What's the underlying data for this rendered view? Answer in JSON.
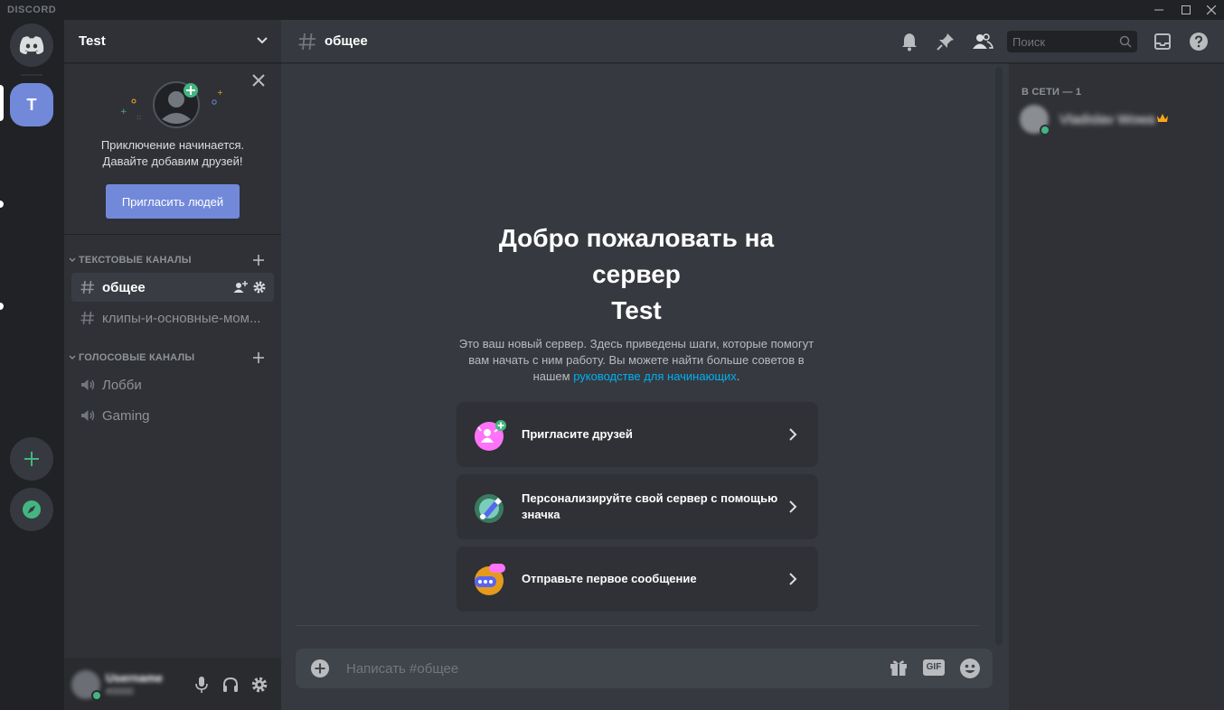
{
  "titlebar": {
    "brand": "DISCORD"
  },
  "rail": {
    "active_server_initial": "T",
    "colors": {
      "active": "#7289da",
      "add": "#43b581",
      "explore": "#43b581"
    }
  },
  "sidebar": {
    "server_name": "Test",
    "invite_card": {
      "text_line1": "Приключение начинается.",
      "text_line2": "Давайте добавим друзей!",
      "button_label": "Пригласить людей"
    },
    "text_category": "ТЕКСТОВЫЕ КАНАЛЫ",
    "text_channels": [
      {
        "name": "общее"
      },
      {
        "name": "клипы-и-основные-мом..."
      }
    ],
    "voice_category": "ГОЛОСОВЫЕ КАНАЛЫ",
    "voice_channels": [
      {
        "name": "Лобби"
      },
      {
        "name": "Gaming"
      }
    ],
    "user": {
      "name": "Username",
      "tag": "#0000"
    }
  },
  "main": {
    "channel_title": "общее",
    "search_placeholder": "Поиск",
    "welcome": {
      "title_line1": "Добро пожаловать на",
      "title_line2": "сервер",
      "title_line3": "Test",
      "desc_part1": "Это ваш новый сервер. Здесь приведены шаги, которые помогут вам начать с ним работу. Вы можете найти больше советов в нашем ",
      "desc_link": "руководстве для начинающих",
      "desc_end": "."
    },
    "cards": [
      {
        "label": "Пригласите друзей"
      },
      {
        "label": "Персонализируйте свой сервер с помощью значка"
      },
      {
        "label": "Отправьте первое сообщение"
      }
    ],
    "composer_placeholder": "Написать #общее",
    "gif_label": "GIF"
  },
  "members": {
    "category": "В СЕТИ — 1",
    "list": [
      {
        "name": "Vladislav Wowa"
      }
    ]
  }
}
